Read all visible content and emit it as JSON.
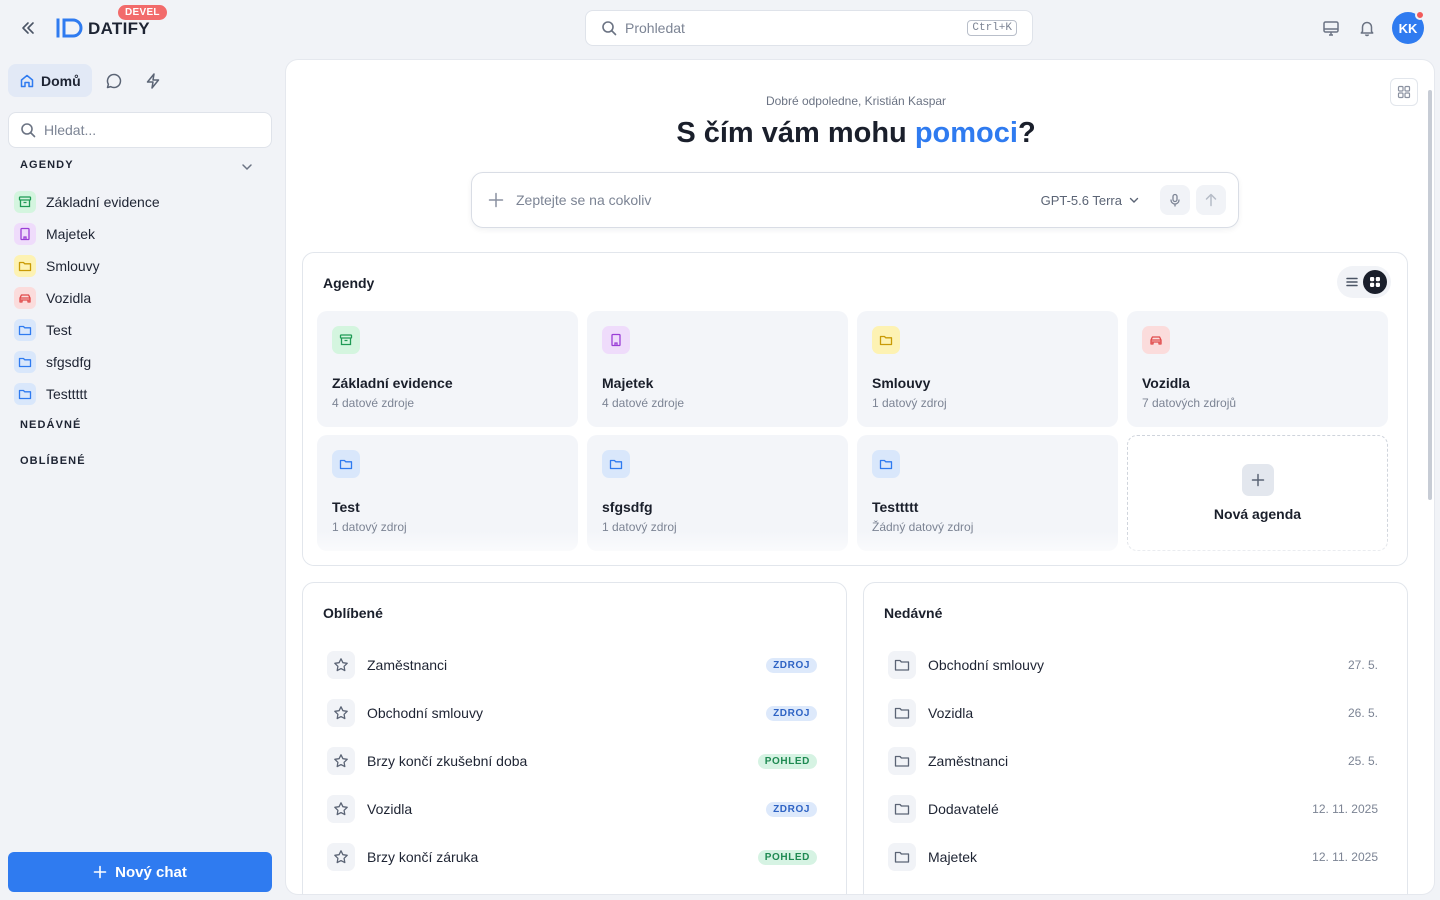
{
  "app": {
    "name": "DATIFY",
    "env_badge": "DEVEL",
    "search_placeholder": "Prohledat",
    "search_shortcut": "Ctrl+K",
    "avatar_initials": "KK",
    "accent_color": "#2f7bf0"
  },
  "sidebar": {
    "home_tab": "Domů",
    "search_placeholder": "Hledat...",
    "sections": {
      "agendas": "AGENDY",
      "recent": "NEDÁVNÉ",
      "favorites": "OBLÍBENÉ"
    },
    "items": [
      {
        "label": "Základní evidence",
        "icon": "archive-icon",
        "color": "green"
      },
      {
        "label": "Majetek",
        "icon": "building-icon",
        "color": "purple"
      },
      {
        "label": "Smlouvy",
        "icon": "folder-icon",
        "color": "yellow"
      },
      {
        "label": "Vozidla",
        "icon": "car-icon",
        "color": "red"
      },
      {
        "label": "Test",
        "icon": "folder-icon",
        "color": "blue"
      },
      {
        "label": "sfgsdfg",
        "icon": "folder-icon",
        "color": "blue"
      },
      {
        "label": "Testtttt",
        "icon": "folder-icon",
        "color": "blue"
      }
    ],
    "new_chat": "Nový chat"
  },
  "main": {
    "greeting": "Dobré odpoledne, Kristián Kaspar",
    "headline_pre": "S čím vám mohu ",
    "headline_accent": "pomoci",
    "headline_post": "?",
    "ask_placeholder": "Zeptejte se na cokoliv",
    "model": "GPT-5.6 Terra"
  },
  "agendas": {
    "title": "Agendy",
    "cards": [
      {
        "title": "Základní evidence",
        "subtitle": "4 datové zdroje",
        "icon": "archive-icon"
      },
      {
        "title": "Majetek",
        "subtitle": "4 datové zdroje",
        "icon": "building-icon"
      },
      {
        "title": "Smlouvy",
        "subtitle": "1 datový zdroj",
        "icon": "folder-icon"
      },
      {
        "title": "Vozidla",
        "subtitle": "7 datových zdrojů",
        "icon": "car-icon"
      },
      {
        "title": "Test",
        "subtitle": "1 datový zdroj",
        "icon": "folder-icon"
      },
      {
        "title": "sfgsdfg",
        "subtitle": "1 datový zdroj",
        "icon": "folder-icon"
      },
      {
        "title": "Testtttt",
        "subtitle": "Žádný datový zdroj",
        "icon": "folder-icon"
      }
    ],
    "new_label": "Nová agenda"
  },
  "favorites": {
    "title": "Oblíbené",
    "items": [
      {
        "label": "Zaměstnanci",
        "tag": "ZDROJ"
      },
      {
        "label": "Obchodní smlouvy",
        "tag": "ZDROJ"
      },
      {
        "label": "Brzy končí zkušební doba",
        "tag": "POHLED"
      },
      {
        "label": "Vozidla",
        "tag": "ZDROJ"
      },
      {
        "label": "Brzy končí záruka",
        "tag": "POHLED"
      }
    ]
  },
  "recent": {
    "title": "Nedávné",
    "items": [
      {
        "label": "Obchodní smlouvy",
        "date": "27. 5."
      },
      {
        "label": "Vozidla",
        "date": "26. 5."
      },
      {
        "label": "Zaměstnanci",
        "date": "25. 5."
      },
      {
        "label": "Dodavatelé",
        "date": "12. 11. 2025"
      },
      {
        "label": "Majetek",
        "date": "12. 11. 2025"
      }
    ]
  }
}
